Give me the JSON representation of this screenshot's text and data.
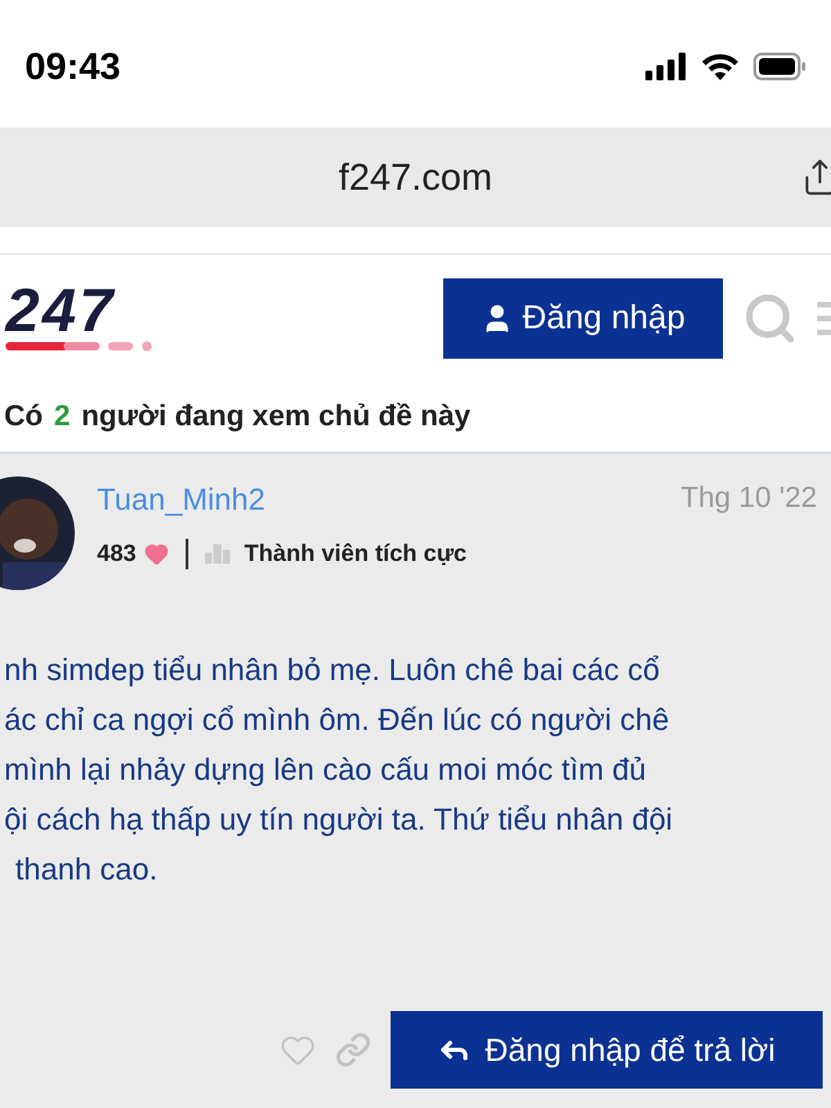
{
  "status_bar": {
    "time": "09:43"
  },
  "address_bar": {
    "url": "f247.com"
  },
  "header": {
    "logo": "247",
    "login_button": "Đăng nhập"
  },
  "viewers": {
    "prefix": "Có",
    "count": "2",
    "suffix": "người đang xem chủ đề này"
  },
  "post": {
    "author": "Tuan_Minh2",
    "date": "Thg 10 '22",
    "likes": "483",
    "rank": "Thành viên tích cực",
    "lines": [
      "nh simdep tiểu nhân bỏ mẹ. Luôn chê bai các cổ",
      "ác chỉ ca ngợi cổ mình ôm. Đến lúc có người chê",
      "mình lại nhảy dựng lên cào cấu moi móc tìm đủ",
      "ội cách hạ thấp uy tín người ta. Thứ tiểu nhân đội",
      "thanh cao."
    ],
    "reply_button": "Đăng nhập để trả lời"
  }
}
